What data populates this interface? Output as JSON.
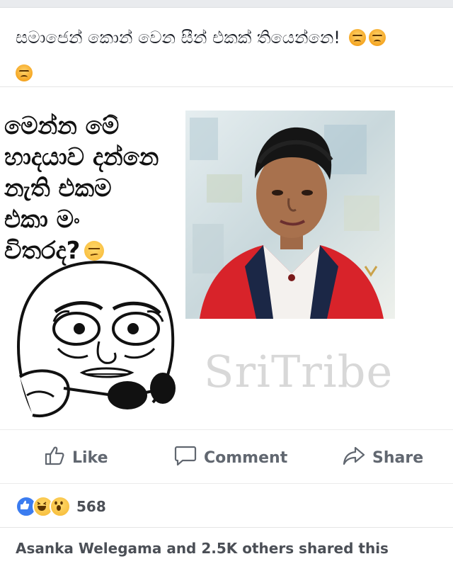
{
  "post": {
    "caption": "සමාජෙන් කොන් වෙන සීන් එකක් තියෙන්නෙ!",
    "caption_emojis": [
      "angry-face-icon",
      "angry-face-icon",
      "angry-face-icon"
    ]
  },
  "meme": {
    "text_lines": [
      "මෙන්න මේ",
      "හාදයාව දන්නෙ",
      "නැති එකම",
      "එකා මං",
      "විතරද?"
    ],
    "watermark": "SriTribe"
  },
  "actions": {
    "like_label": "Like",
    "comment_label": "Comment",
    "share_label": "Share"
  },
  "reactions": {
    "types": [
      "like",
      "haha",
      "wow"
    ],
    "count": "568"
  },
  "shares": {
    "text": "Asanka Welegama and 2.5K others shared this"
  },
  "colors": {
    "like_blue": "#3b7cf0",
    "action_gray": "#616770",
    "jacket_red": "#d8232a"
  }
}
